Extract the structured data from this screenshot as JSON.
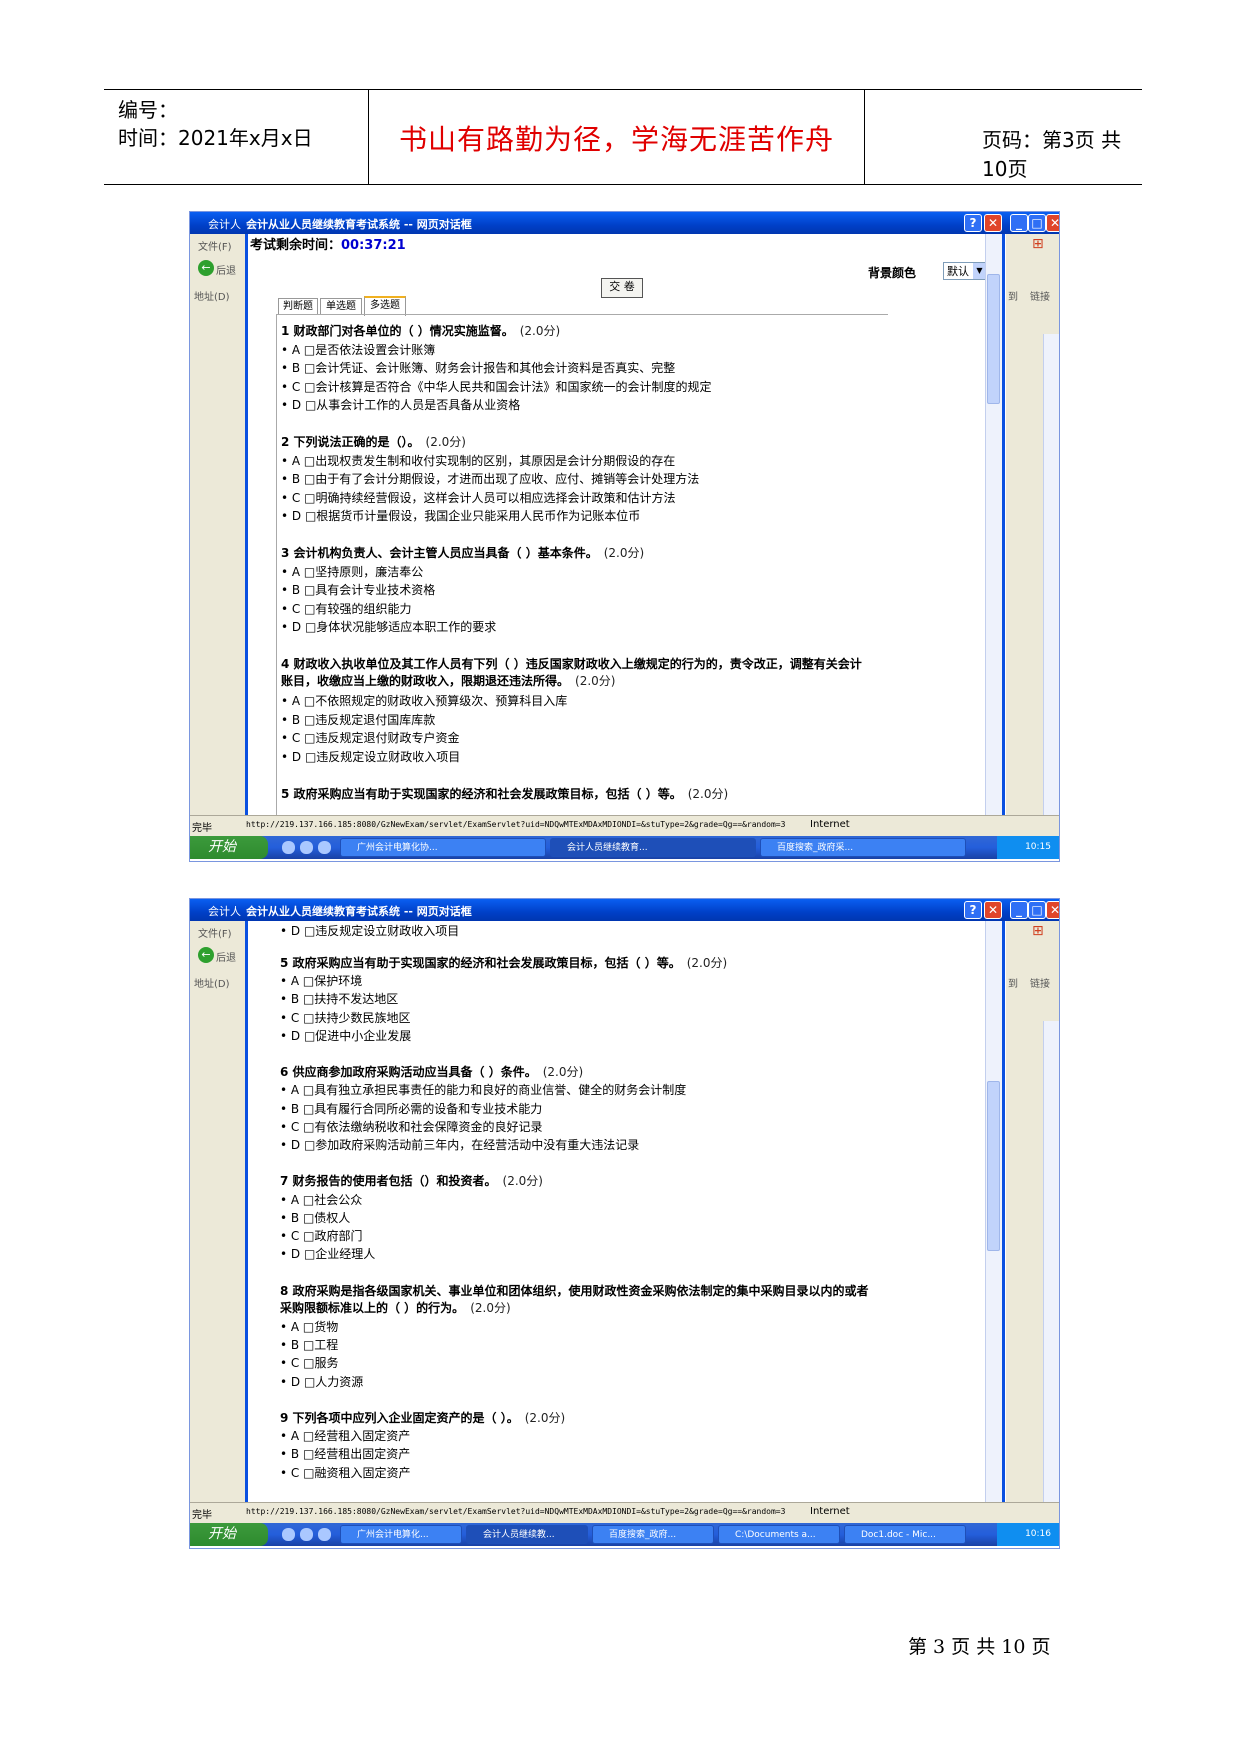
{
  "header": {
    "number_label": "编号：",
    "time_label": "时间：2021年x月x日",
    "motto": "书山有路勤为径，学海无涯苦作舟",
    "page_label": "页码：第3页  共10页"
  },
  "footer": {
    "page_text": "第 3 页 共 10 页"
  },
  "window": {
    "outer_title": "会计人",
    "dialog_title": "会计从业人员继续教育考试系统 -- 网页对话框",
    "menu_file": "文件(F)",
    "back_label": "后退",
    "address_label": "地址(D)",
    "go_label": "到",
    "links_label": "链接",
    "status_done": "完毕",
    "status_url": "http://219.137.166.185:8080/GzNewExam/servlet/ExamServlet?uid=NDQwMTExMDAxMDIONDI=&stuType=2&grade=Qg==&random=3",
    "status_zone": "Internet",
    "start_label": "开始"
  },
  "exam": {
    "timer_label": "考试剩余时间：",
    "timer_value": "00:37:21",
    "bg_color_label": "背景颜色",
    "bg_color_value": "默认",
    "submit_label": "交 卷",
    "tabs": [
      "判断题",
      "单选题",
      "多选题"
    ]
  },
  "screen1": {
    "questions": [
      {
        "title": "1 财政部门对各单位的（ ）情况实施监督。",
        "score": "(2.0分)",
        "options": [
          "A □是否依法设置会计账簿",
          "B □会计凭证、会计账簿、财务会计报告和其他会计资料是否真实、完整",
          "C □会计核算是否符合《中华人民共和国会计法》和国家统一的会计制度的规定",
          "D □从事会计工作的人员是否具备从业资格"
        ]
      },
      {
        "title": "2 下列说法正确的是（）。",
        "score": "(2.0分)",
        "options": [
          "A □出现权责发生制和收付实现制的区别，其原因是会计分期假设的存在",
          "B □由于有了会计分期假设，才进而出现了应收、应付、摊销等会计处理方法",
          "C □明确持续经营假设，这样会计人员可以相应选择会计政策和估计方法",
          "D □根据货币计量假设，我国企业只能采用人民币作为记账本位币"
        ]
      },
      {
        "title": "3 会计机构负责人、会计主管人员应当具备（ ）基本条件。",
        "score": "(2.0分)",
        "options": [
          "A □坚持原则，廉洁奉公",
          "B □具有会计专业技术资格",
          "C □有较强的组织能力",
          "D □身体状况能够适应本职工作的要求"
        ]
      },
      {
        "title": "4 财政收入执收单位及其工作人员有下列（ ）违反国家财政收入上缴规定的行为的，责令改正，调整有关会计账目，收缴应当上缴的财政收入，限期退还违法所得。",
        "score": "(2.0分)",
        "options": [
          "A □不依照规定的财政收入预算级次、预算科目入库",
          "B □违反规定退付国库库款",
          "C □违反规定退付财政专户资金",
          "D □违反规定设立财政收入项目"
        ]
      },
      {
        "title": "5 政府采购应当有助于实现国家的经济和社会发展政策目标，包括（ ）等。",
        "score": "(2.0分)",
        "options": []
      }
    ],
    "taskbar": [
      "广州会计电算化协...",
      "会计人员继续教育...",
      "百度搜索_政府采..."
    ],
    "clock": "10:15"
  },
  "screen2": {
    "top_option": "D □违反规定设立财政收入项目",
    "questions": [
      {
        "title": "5 政府采购应当有助于实现国家的经济和社会发展政策目标，包括（ ）等。",
        "score": "(2.0分)",
        "options": [
          "A □保护环境",
          "B □扶持不发达地区",
          "C □扶持少数民族地区",
          "D □促进中小企业发展"
        ]
      },
      {
        "title": "6 供应商参加政府采购活动应当具备（ ）条件。",
        "score": "(2.0分)",
        "options": [
          "A □具有独立承担民事责任的能力和良好的商业信誉、健全的财务会计制度",
          "B □具有履行合同所必需的设备和专业技术能力",
          "C □有依法缴纳税收和社会保障资金的良好记录",
          "D □参加政府采购活动前三年内，在经营活动中没有重大违法记录"
        ]
      },
      {
        "title": "7 财务报告的使用者包括（）和投资者。",
        "score": "(2.0分)",
        "options": [
          "A □社会公众",
          "B □债权人",
          "C □政府部门",
          "D □企业经理人"
        ]
      },
      {
        "title": "8 政府采购是指各级国家机关、事业单位和团体组织，使用财政性资金采购依法制定的集中采购目录以内的或者采购限额标准以上的（ ）的行为。",
        "score": "(2.0分)",
        "options": [
          "A □货物",
          "B □工程",
          "C □服务",
          "D □人力资源"
        ]
      },
      {
        "title": "9 下列各项中应列入企业固定资产的是（ ）。",
        "score": "(2.0分)",
        "options": [
          "A □经营租入固定资产",
          "B □经营租出固定资产",
          "C □融资租入固定资产"
        ]
      }
    ],
    "taskbar": [
      "广州会计电算化...",
      "会计人员继续教...",
      "百度搜索_政府...",
      "C:\\Documents a...",
      "Doc1.doc - Mic..."
    ],
    "clock": "10:16"
  }
}
